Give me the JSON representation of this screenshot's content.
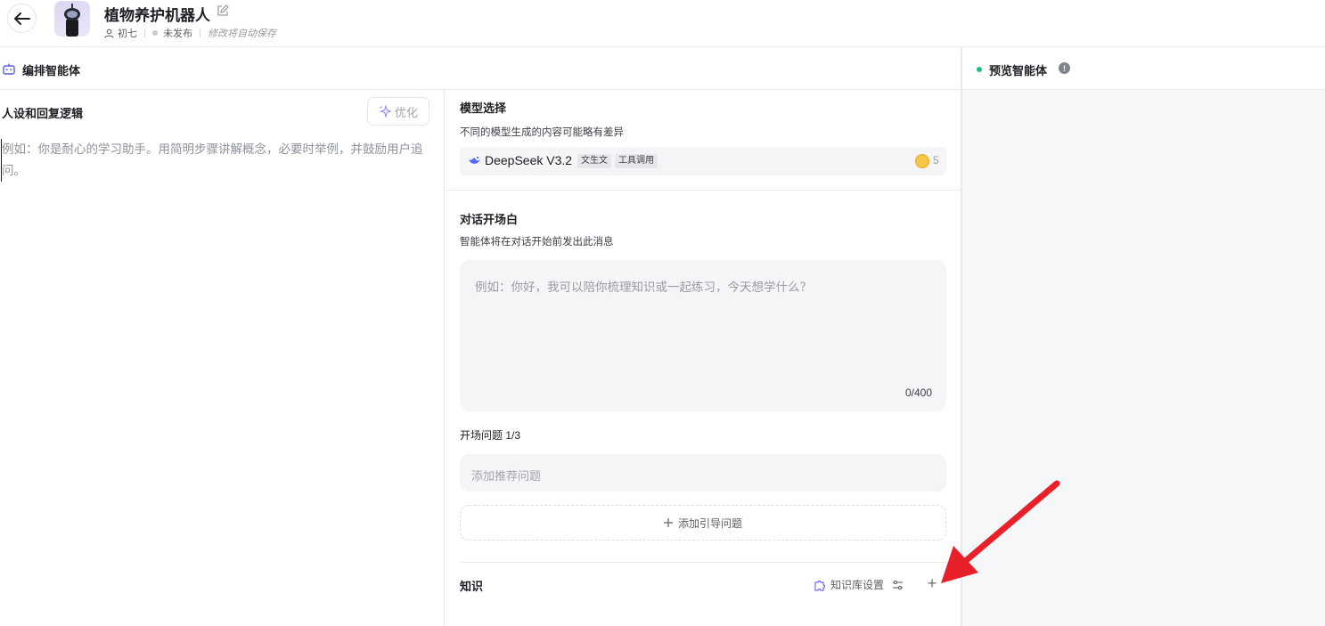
{
  "header": {
    "title": "植物养护机器人",
    "author": "初七",
    "status": "未发布",
    "autosave": "修改将自动保存"
  },
  "left_head": {
    "label": "编排智能体"
  },
  "right_head": {
    "label": "预览智能体",
    "info": "!"
  },
  "persona": {
    "title": "人设和回复逻辑",
    "optimize_label": "优化",
    "placeholder": "例如：你是耐心的学习助手。用简明步骤讲解概念，必要时举例，并鼓励用户追问。"
  },
  "model": {
    "title": "模型选择",
    "subtitle": "不同的模型生成的内容可能略有差异",
    "name": "DeepSeek V3.2",
    "tags": [
      "文生文",
      "工具调用"
    ],
    "credit": "5"
  },
  "opening": {
    "title": "对话开场白",
    "subtitle": "智能体将在对话开始前发出此消息",
    "placeholder": "例如：你好，我可以陪你梳理知识或一起练习，今天想学什么？",
    "count": "0/400",
    "questions_label": "开场问题 1/3",
    "question_placeholder": "添加推荐问题",
    "add_question_label": "添加引导问题"
  },
  "knowledge": {
    "title": "知识",
    "settings_label": "知识库设置",
    "add_symbol": "+"
  },
  "colors": {
    "accent": "#1fbf7a",
    "annotation_arrow": "#e8202a"
  }
}
